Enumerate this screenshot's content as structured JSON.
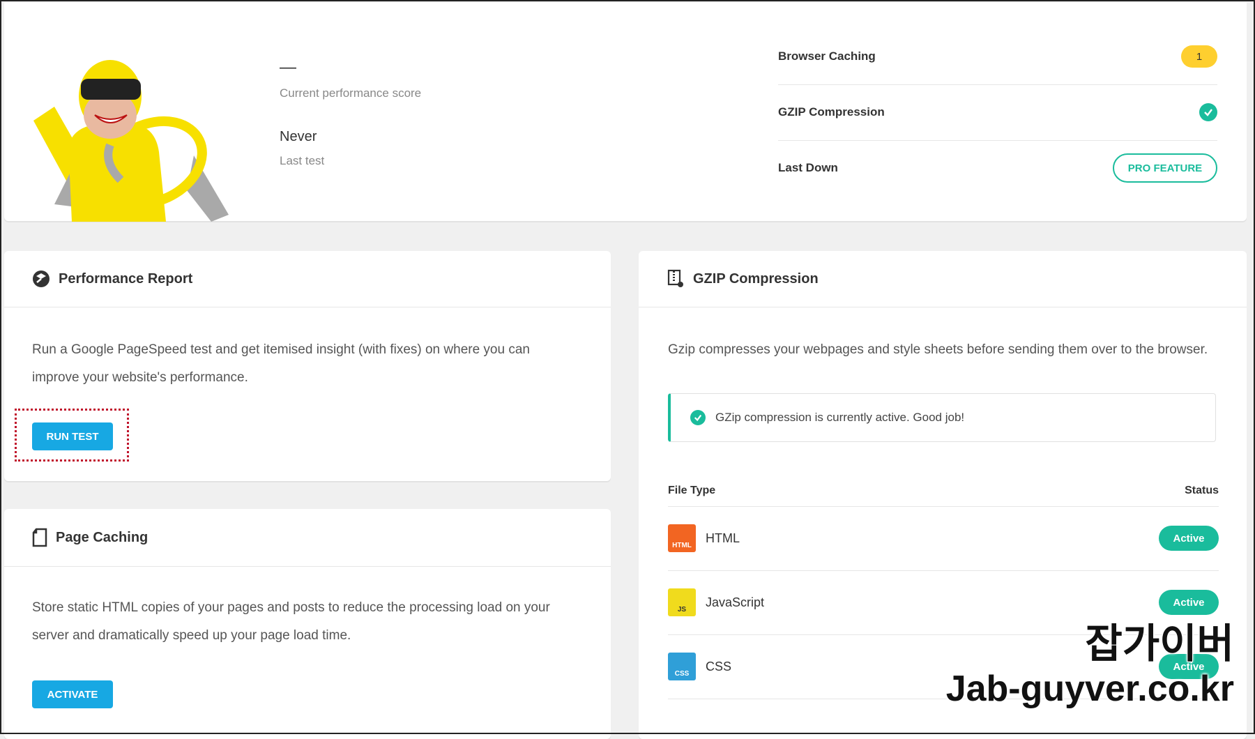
{
  "summary": {
    "score_value": "—",
    "score_label": "Current performance score",
    "last_test_value": "Never",
    "last_test_label": "Last test",
    "stats": [
      {
        "label": "Browser Caching",
        "badge": "1"
      },
      {
        "label": "GZIP Compression",
        "status": "check"
      },
      {
        "label": "Last Down",
        "button": "PRO FEATURE"
      }
    ]
  },
  "performance_report": {
    "title": "Performance Report",
    "description": "Run a Google PageSpeed test and get itemised insight (with fixes) on where you can improve your website's performance.",
    "button": "RUN TEST"
  },
  "page_caching": {
    "title": "Page Caching",
    "description": "Store static HTML copies of your pages and posts to reduce the processing load on your server and dramatically speed up your page load time.",
    "button": "ACTIVATE"
  },
  "gzip": {
    "title": "GZIP Compression",
    "description": "Gzip compresses your webpages and style sheets before sending them over to the browser.",
    "notice": "GZip compression is currently active. Good job!",
    "col_file_type": "File Type",
    "col_status": "Status",
    "rows": [
      {
        "icon_text": "HTML",
        "name": "HTML",
        "status": "Active",
        "color": "#f26522"
      },
      {
        "icon_text": "JS",
        "name": "JavaScript",
        "status": "Active",
        "color": "#f0db1d"
      },
      {
        "icon_text": "CSS",
        "name": "CSS",
        "status": "Active",
        "color": "#2f9fd8"
      }
    ]
  },
  "watermark": {
    "korean": "잡가이버",
    "url": "Jab-guyver.co.kr"
  },
  "colors": {
    "accent_green": "#1abc9c",
    "button_blue": "#17a8e3",
    "badge_yellow": "#fecf2f"
  }
}
